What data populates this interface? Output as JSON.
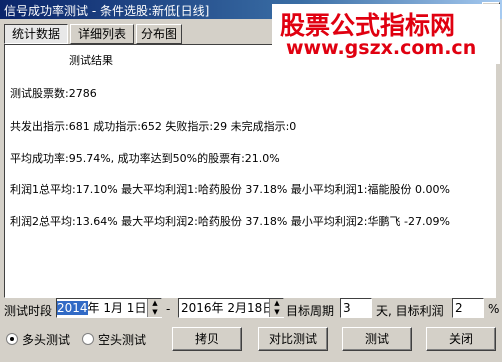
{
  "window": {
    "title": "信号成功率测试 - 条件选股:新低[日线]",
    "close_glyph": "✕"
  },
  "watermark": {
    "line1": "股票公式指标网",
    "line2": "www.gszx.com.cn"
  },
  "tabs": [
    "统计数据",
    "详细列表",
    "分布图"
  ],
  "results": {
    "header": "测试结果",
    "stock_count": "测试股票数:2786",
    "signals": "共发出指示:681 成功指示:652 失败指示:29 未完成指示:0",
    "avg_success": "平均成功率:95.74%, 成功率达到50%的股票有:21.0%",
    "profit1": "利润1总平均:17.10% 最大平均利润1:哈药股份 37.18% 最小平均利润1:福能股份  0.00%",
    "profit2": "利润2总平均:13.64% 最大平均利润2:哈药股份 37.18% 最小平均利润2:华鹏飞   -27.09%"
  },
  "controls": {
    "period_label": "测试时段",
    "start_year": "2014",
    "start_rest": "年  1月  1日",
    "dash": "-",
    "end_date": "2016年  2月18日",
    "target_period_label": "目标周期",
    "target_period": "3",
    "target_profit_label": "天, 目标利润",
    "target_profit": "2",
    "percent": "%",
    "spin_up": "▲",
    "spin_down": "▼"
  },
  "radios": [
    {
      "label": "多头测试",
      "selected": true
    },
    {
      "label": "空头测试",
      "selected": false
    }
  ],
  "buttons": {
    "copy": "拷贝",
    "compare": "对比测试",
    "test": "测试",
    "close": "关闭"
  }
}
